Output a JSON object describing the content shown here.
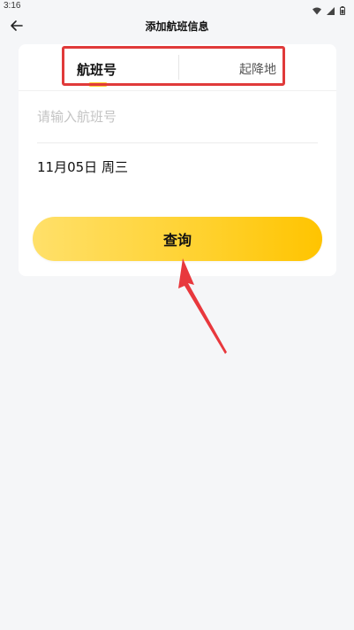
{
  "status_bar": {
    "time": "3:16"
  },
  "header": {
    "title": "添加航班信息"
  },
  "tabs": [
    {
      "label": "航班号",
      "active": true
    },
    {
      "label": "起降地",
      "active": false
    }
  ],
  "form": {
    "flight_placeholder": "请输入航班号",
    "flight_value": "",
    "date_text": "11月05日 周三"
  },
  "actions": {
    "query_label": "查询"
  },
  "colors": {
    "accent": "#ffd02e",
    "highlight": "#e03a3a",
    "background": "#f5f6f8"
  },
  "icons": {
    "back": "arrow-left-icon",
    "wifi": "wifi-icon",
    "signal": "signal-icon",
    "battery": "battery-icon"
  }
}
